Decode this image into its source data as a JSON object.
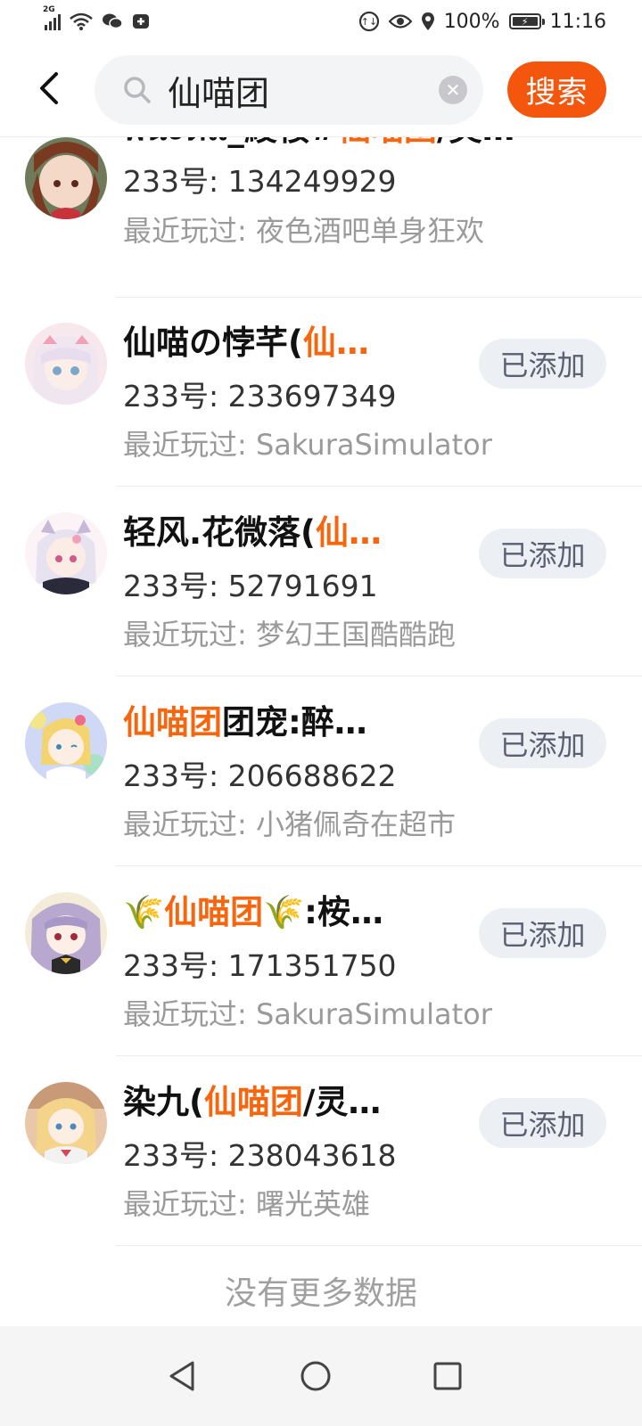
{
  "status_bar": {
    "network": "2G",
    "battery": "100%",
    "time": "11:16"
  },
  "search": {
    "query": "仙喵团",
    "button_label": "搜索"
  },
  "results": [
    {
      "name_parts": [
        "พีนะตีแ_綾桜#",
        "仙喵团",
        "/灵…"
      ],
      "uid": "233号: 134249929",
      "recent": "最近玩过: 夜色酒吧单身狂欢",
      "action": ""
    },
    {
      "name_parts": [
        "仙喵の悖芊(",
        "仙…",
        ""
      ],
      "uid": "233号: 233697349",
      "recent": "最近玩过: SakuraSimulator",
      "action": "已添加"
    },
    {
      "name_parts": [
        "轻风.花微落(",
        "仙…",
        ""
      ],
      "uid": "233号: 52791691",
      "recent": "最近玩过: 梦幻王国酷酷跑",
      "action": "已添加"
    },
    {
      "name_parts": [
        "",
        "仙喵团",
        "团宠:醉…"
      ],
      "uid": "233号: 206688622",
      "recent": "最近玩过: 小猪佩奇在超市",
      "action": "已添加"
    },
    {
      "name_parts": [
        "🌾",
        "仙喵团",
        "🌾:桉…"
      ],
      "uid": "233号: 171351750",
      "recent": "最近玩过: SakuraSimulator",
      "action": "已添加"
    },
    {
      "name_parts": [
        "染九(",
        "仙喵团",
        "/灵…"
      ],
      "uid": "233号: 238043618",
      "recent": "最近玩过: 曙光英雄",
      "action": "已添加"
    }
  ],
  "footer": {
    "no_more": "没有更多数据"
  },
  "colors": {
    "accent": "#f5560e",
    "highlight": "#f5660f",
    "added_bg": "#eceff4"
  }
}
